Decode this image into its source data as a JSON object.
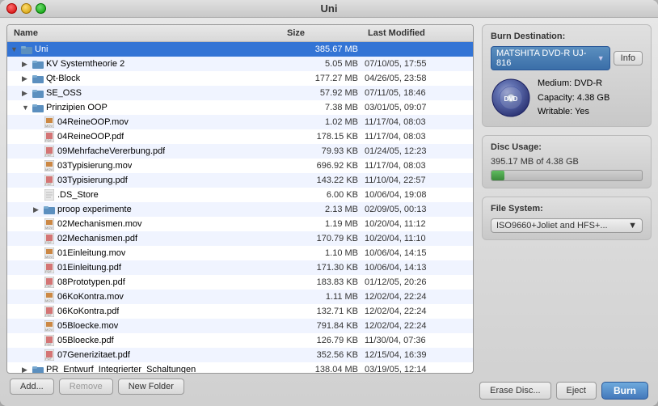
{
  "window": {
    "title": "Uni"
  },
  "header": {
    "name_col": "Name",
    "size_col": "Size",
    "modified_col": "Last Modified"
  },
  "files": [
    {
      "id": "uni",
      "name": "Uni",
      "size": "385.67 MB",
      "date": "",
      "indent": 0,
      "type": "folder-open",
      "arrow": "▼"
    },
    {
      "id": "kv",
      "name": "KV Systemtheorie 2",
      "size": "5.05 MB",
      "date": "07/10/05, 17:55",
      "indent": 1,
      "type": "folder",
      "arrow": "▶"
    },
    {
      "id": "qt",
      "name": "Qt-Block",
      "size": "177.27 MB",
      "date": "04/26/05, 23:58",
      "indent": 1,
      "type": "folder",
      "arrow": "▶"
    },
    {
      "id": "se",
      "name": "SE_OSS",
      "size": "57.92 MB",
      "date": "07/11/05, 18:46",
      "indent": 1,
      "type": "folder",
      "arrow": "▶"
    },
    {
      "id": "prinz",
      "name": "Prinzipien OOP",
      "size": "7.38 MB",
      "date": "03/01/05, 09:07",
      "indent": 1,
      "type": "folder-open",
      "arrow": "▼"
    },
    {
      "id": "f1",
      "name": "04ReineOOP.mov",
      "size": "1.02 MB",
      "date": "11/17/04, 08:03",
      "indent": 2,
      "type": "mov",
      "arrow": ""
    },
    {
      "id": "f2",
      "name": "04ReineOOP.pdf",
      "size": "178.15 KB",
      "date": "11/17/04, 08:03",
      "indent": 2,
      "type": "pdf",
      "arrow": ""
    },
    {
      "id": "f3",
      "name": "09MehrfacheVererbung.pdf",
      "size": "79.93 KB",
      "date": "01/24/05, 12:23",
      "indent": 2,
      "type": "pdf",
      "arrow": ""
    },
    {
      "id": "f4",
      "name": "03Typisierung.mov",
      "size": "696.92 KB",
      "date": "11/17/04, 08:03",
      "indent": 2,
      "type": "mov",
      "arrow": ""
    },
    {
      "id": "f5",
      "name": "03Typisierung.pdf",
      "size": "143.22 KB",
      "date": "11/10/04, 22:57",
      "indent": 2,
      "type": "pdf",
      "arrow": ""
    },
    {
      "id": "f6",
      "name": ".DS_Store",
      "size": "6.00 KB",
      "date": "10/06/04, 19:08",
      "indent": 2,
      "type": "doc",
      "arrow": ""
    },
    {
      "id": "proop",
      "name": "proop experimente",
      "size": "2.13 MB",
      "date": "02/09/05, 00:13",
      "indent": 2,
      "type": "folder",
      "arrow": "▶"
    },
    {
      "id": "f7",
      "name": "02Mechanismen.mov",
      "size": "1.19 MB",
      "date": "10/20/04, 11:12",
      "indent": 2,
      "type": "mov",
      "arrow": ""
    },
    {
      "id": "f8",
      "name": "02Mechanismen.pdf",
      "size": "170.79 KB",
      "date": "10/20/04, 11:10",
      "indent": 2,
      "type": "pdf",
      "arrow": ""
    },
    {
      "id": "f9",
      "name": "01Einleitung.mov",
      "size": "1.10 MB",
      "date": "10/06/04, 14:15",
      "indent": 2,
      "type": "mov",
      "arrow": ""
    },
    {
      "id": "f10",
      "name": "01Einleitung.pdf",
      "size": "171.30 KB",
      "date": "10/06/04, 14:13",
      "indent": 2,
      "type": "pdf",
      "arrow": ""
    },
    {
      "id": "f11",
      "name": "08Prototypen.pdf",
      "size": "183.83 KB",
      "date": "01/12/05, 20:26",
      "indent": 2,
      "type": "pdf",
      "arrow": ""
    },
    {
      "id": "f12",
      "name": "06KoKontra.mov",
      "size": "1.11 MB",
      "date": "12/02/04, 22:24",
      "indent": 2,
      "type": "mov",
      "arrow": ""
    },
    {
      "id": "f13",
      "name": "06KoKontra.pdf",
      "size": "132.71 KB",
      "date": "12/02/04, 22:24",
      "indent": 2,
      "type": "pdf",
      "arrow": ""
    },
    {
      "id": "f14",
      "name": "05Bloecke.mov",
      "size": "791.84 KB",
      "date": "12/02/04, 22:24",
      "indent": 2,
      "type": "mov",
      "arrow": ""
    },
    {
      "id": "f15",
      "name": "05Bloecke.pdf",
      "size": "126.79 KB",
      "date": "11/30/04, 07:36",
      "indent": 2,
      "type": "pdf",
      "arrow": ""
    },
    {
      "id": "f16",
      "name": "07Generizitaet.pdf",
      "size": "352.56 KB",
      "date": "12/15/04, 16:39",
      "indent": 2,
      "type": "pdf",
      "arrow": ""
    },
    {
      "id": "pr_entwurf",
      "name": "PR_Entwurf_Integrierter_Schaltungen",
      "size": "138.04 MB",
      "date": "03/19/05, 12:14",
      "indent": 1,
      "type": "folder",
      "arrow": "▶"
    }
  ],
  "bottom_buttons": {
    "add": "Add...",
    "remove": "Remove",
    "new_folder": "New Folder"
  },
  "right_panel": {
    "burn_destination_title": "Burn Destination:",
    "drive_name": "MATSHITA DVD-R UJ-816",
    "info_btn": "Info",
    "medium_label": "Medium:",
    "medium_value": "DVD-R",
    "capacity_label": "Capacity:",
    "capacity_value": "4.38 GB",
    "writable_label": "Writable:",
    "writable_value": "Yes",
    "disc_usage_title": "Disc Usage:",
    "disc_usage_text": "395.17 MB of 4.38 GB",
    "disc_fill_percent": 8.8,
    "filesystem_title": "File System:",
    "filesystem_value": "ISO9660+Joliet and HFS+...",
    "erase_btn": "Erase Disc...",
    "eject_btn": "Eject",
    "burn_btn": "Burn"
  }
}
